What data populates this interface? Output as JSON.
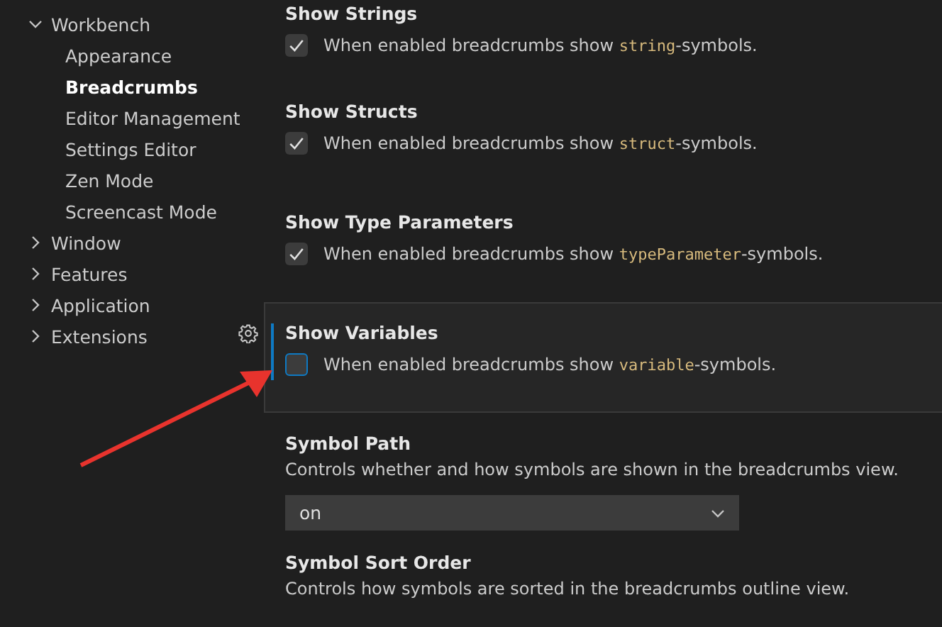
{
  "sidebar": {
    "tree": [
      {
        "label": "Workbench",
        "expanded": true,
        "selected": false,
        "children": [
          {
            "label": "Appearance",
            "selected": false
          },
          {
            "label": "Breadcrumbs",
            "selected": true
          },
          {
            "label": "Editor Management",
            "selected": false
          },
          {
            "label": "Settings Editor",
            "selected": false
          },
          {
            "label": "Zen Mode",
            "selected": false
          },
          {
            "label": "Screencast Mode",
            "selected": false
          }
        ]
      },
      {
        "label": "Window",
        "expanded": false,
        "selected": false
      },
      {
        "label": "Features",
        "expanded": false,
        "selected": false
      },
      {
        "label": "Application",
        "expanded": false,
        "selected": false
      },
      {
        "label": "Extensions",
        "expanded": false,
        "selected": false
      }
    ]
  },
  "settings": [
    {
      "kind": "checkbox",
      "title": "Show Strings",
      "checked": true,
      "focused": false,
      "description": {
        "before": "When enabled breadcrumbs show ",
        "code": "string",
        "after": "-symbols."
      }
    },
    {
      "kind": "checkbox",
      "title": "Show Structs",
      "checked": true,
      "focused": false,
      "description": {
        "before": "When enabled breadcrumbs show ",
        "code": "struct",
        "after": "-symbols."
      }
    },
    {
      "kind": "checkbox",
      "title": "Show Type Parameters",
      "checked": true,
      "focused": false,
      "description": {
        "before": "When enabled breadcrumbs show ",
        "code": "typeParameter",
        "after": "-symbols."
      }
    },
    {
      "kind": "checkbox",
      "title": "Show Variables",
      "checked": false,
      "focused": true,
      "description": {
        "before": "When enabled breadcrumbs show ",
        "code": "variable",
        "after": "-symbols."
      }
    },
    {
      "kind": "dropdown",
      "title": "Symbol Path",
      "focused": false,
      "text": "Controls whether and how symbols are shown in the breadcrumbs view.",
      "value": "on"
    },
    {
      "kind": "text",
      "title": "Symbol Sort Order",
      "focused": false,
      "text": "Controls how symbols are sorted in the breadcrumbs outline view."
    }
  ]
}
